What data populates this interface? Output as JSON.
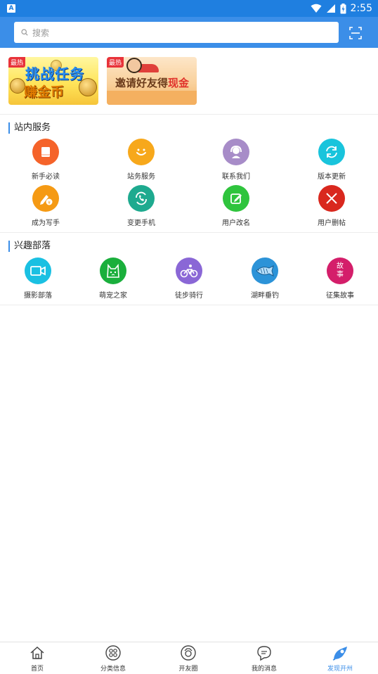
{
  "status_bar": {
    "time": "2:55",
    "indicator": "A"
  },
  "search": {
    "placeholder": "搜索"
  },
  "banners": [
    {
      "badge": "最热",
      "line1": "挑战任务",
      "line2": "赚金币"
    },
    {
      "badge": "最热",
      "text_plain": "邀请好友得",
      "text_highlight": "现金"
    }
  ],
  "station_services": {
    "title": "站内服务",
    "items": [
      {
        "label": "新手必读",
        "icon": "book-icon",
        "color": "#f5632a"
      },
      {
        "label": "站务服务",
        "icon": "smiley-icon",
        "color": "#f7a81b"
      },
      {
        "label": "联系我们",
        "icon": "headset-icon",
        "color": "#a78cc8"
      },
      {
        "label": "版本更新",
        "icon": "refresh-icon",
        "color": "#19c4dc"
      },
      {
        "label": "成为写手",
        "icon": "pen-coin-icon",
        "color": "#f59a14"
      },
      {
        "label": "变更手机",
        "icon": "phone-swap-icon",
        "color": "#1eaa8f"
      },
      {
        "label": "用户改名",
        "icon": "edit-icon",
        "color": "#2fc43d"
      },
      {
        "label": "用户删帖",
        "icon": "close-icon",
        "color": "#d9281e"
      }
    ]
  },
  "interest_tribes": {
    "title": "兴趣部落",
    "items": [
      {
        "label": "摄影部落",
        "icon": "video-camera-icon",
        "color": "#1ac0e2"
      },
      {
        "label": "萌宠之家",
        "icon": "pet-icon",
        "color": "#1aaf3c"
      },
      {
        "label": "徒步骑行",
        "icon": "bicycle-icon",
        "color": "#8a67d6"
      },
      {
        "label": "湖畔垂钓",
        "icon": "fish-icon",
        "color": "#2c93d8"
      },
      {
        "label": "征集故事",
        "icon": "story-icon",
        "color": "#d41e6a",
        "icon_text": "故事"
      }
    ]
  },
  "tab_bar": {
    "items": [
      {
        "label": "首页",
        "icon": "home-icon"
      },
      {
        "label": "分类信息",
        "icon": "category-icon"
      },
      {
        "label": "开友圈",
        "icon": "camera-circle-icon"
      },
      {
        "label": "我的消息",
        "icon": "message-icon"
      },
      {
        "label": "发现开州",
        "icon": "discover-icon",
        "active": true
      }
    ],
    "active_color": "#3b8ee8"
  },
  "theme": {
    "primary": "#3b8ee8",
    "status_bar": "#1f7fe0"
  }
}
